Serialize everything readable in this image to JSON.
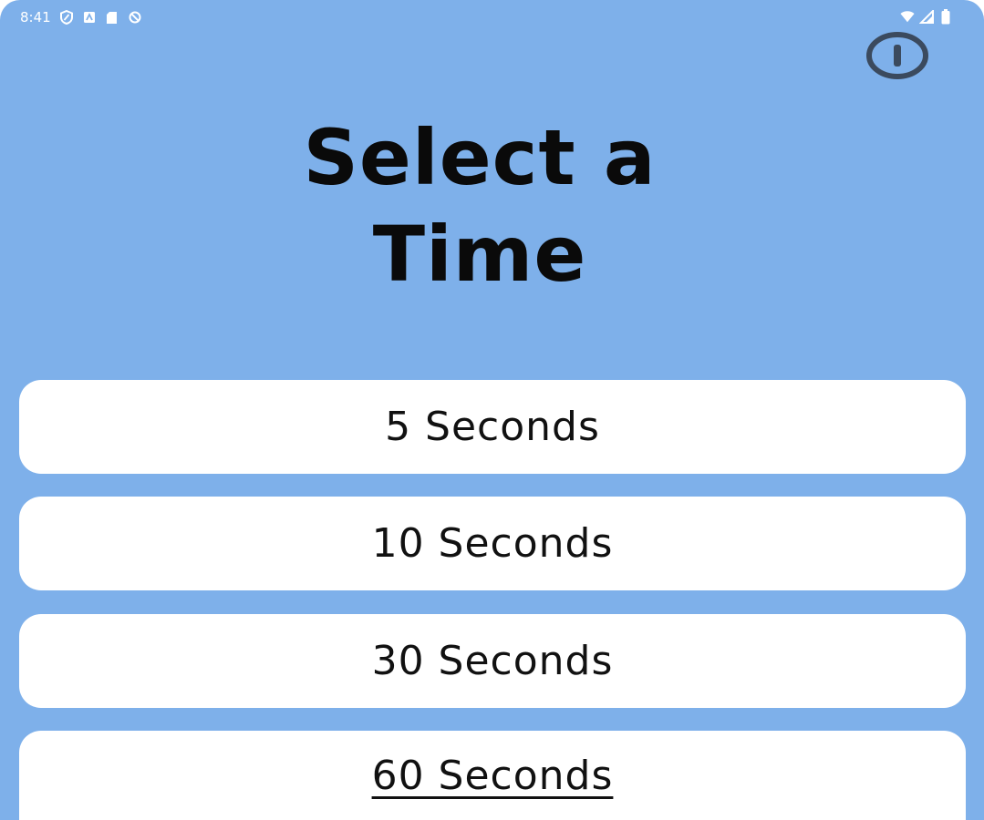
{
  "status_bar": {
    "time": "8:41",
    "left_icons": [
      "shield-icon",
      "notification-box-icon",
      "sd-card-icon",
      "block-icon"
    ],
    "right_icons": [
      "wifi-icon",
      "signal-icon",
      "battery-icon"
    ]
  },
  "header": {
    "info_icon": "info-icon",
    "title_line_1": "Select a",
    "title_line_2": "Time"
  },
  "options": [
    {
      "label": "5 Seconds"
    },
    {
      "label": "10 Seconds"
    },
    {
      "label": "30 Seconds"
    },
    {
      "label": "60 Seconds"
    }
  ],
  "colors": {
    "background": "#7eb0ea",
    "button": "#ffffff",
    "text": "#111111",
    "icon": "#3b4a5e"
  }
}
